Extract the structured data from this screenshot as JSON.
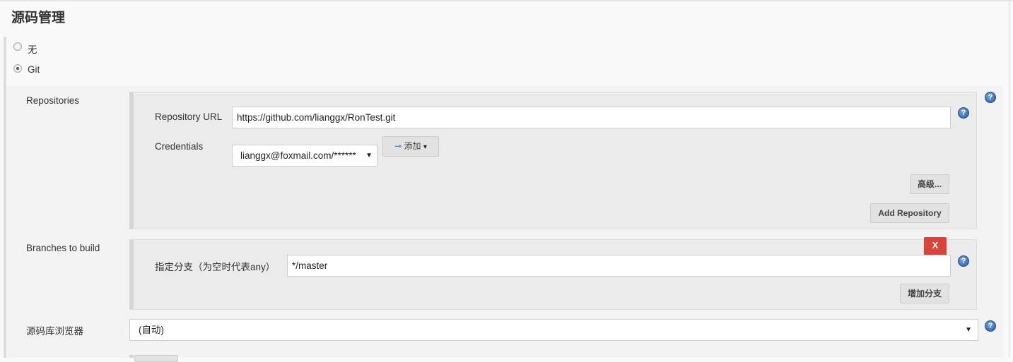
{
  "section_title": "源码管理",
  "scm_options": [
    {
      "label": "无",
      "selected": false
    },
    {
      "label": "Git",
      "selected": true
    }
  ],
  "repositories": {
    "label": "Repositories",
    "url_label": "Repository URL",
    "url_value": "https://github.com/lianggx/RonTest.git",
    "credentials_label": "Credentials",
    "credentials_value": "lianggx@foxmail.com/******",
    "add_label": "添加",
    "advanced_label": "高级...",
    "add_repository_label": "Add Repository"
  },
  "branches": {
    "label": "Branches to build",
    "specifier_label": "指定分支（为空时代表any）",
    "specifier_value": "*/master",
    "delete_label": "X",
    "add_branch_label": "增加分支"
  },
  "browser": {
    "label": "源码库浏览器",
    "value": "(自动)"
  },
  "help_glyph": "?",
  "colors": {
    "delete": "#d9443a",
    "help": "#24569a"
  }
}
